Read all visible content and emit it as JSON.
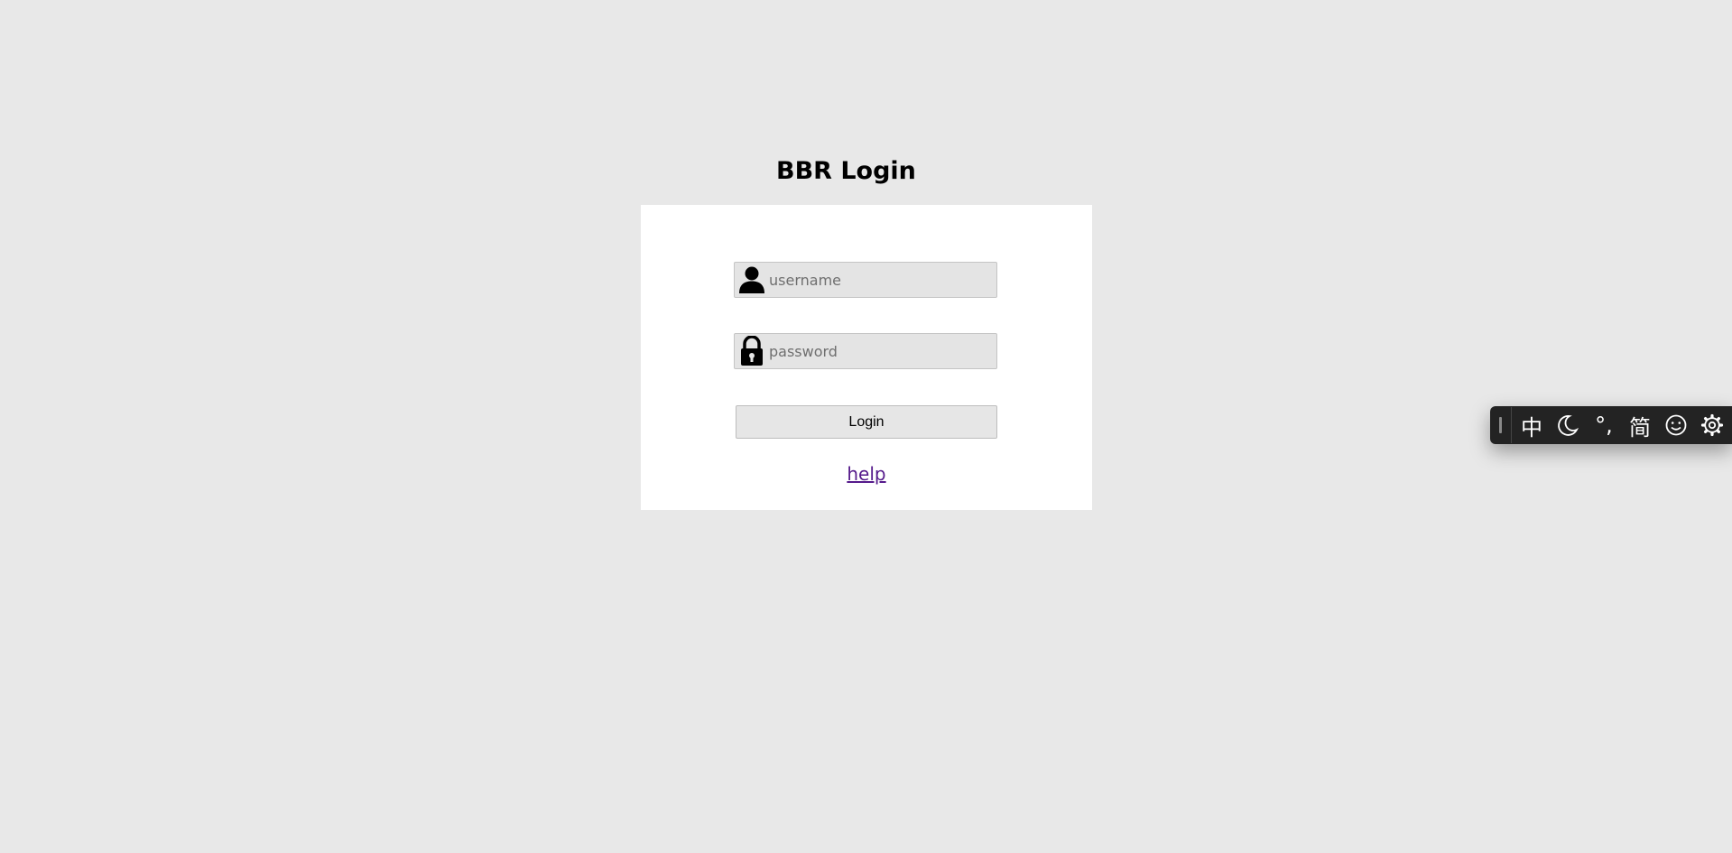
{
  "page": {
    "title": "BBR Login"
  },
  "form": {
    "username_placeholder": "username",
    "username_value": "",
    "password_placeholder": "password",
    "password_value": "",
    "login_label": "Login",
    "help_label": "help",
    "help_link_color": "#551a8b"
  },
  "ime_toolbar": {
    "mode_label": "中",
    "punctuation_label": "°,",
    "script_label": "简",
    "icons": [
      "grip-handle-icon",
      "moon-icon",
      "smiley-icon",
      "gear-icon"
    ]
  }
}
